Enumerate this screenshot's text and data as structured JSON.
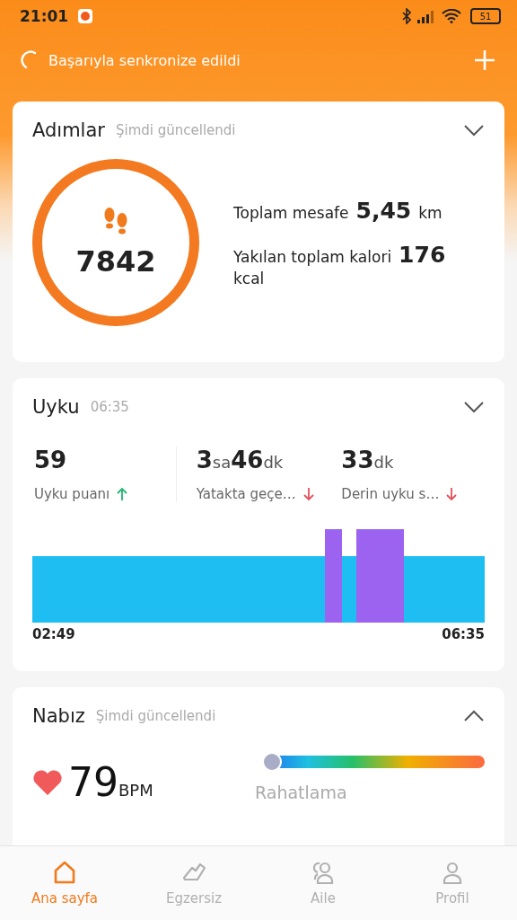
{
  "status_bar": {
    "time": "21:01",
    "battery": "51"
  },
  "header": {
    "sync_text": "Başarıyla senkronize edildi"
  },
  "steps_card": {
    "title": "Adımlar",
    "subtitle": "Şimdi güncellendi",
    "expanded": false,
    "steps": "7842",
    "distance_label": "Toplam mesafe",
    "distance_value": "5,45",
    "distance_unit": "km",
    "calories_label": "Yakılan toplam kalori",
    "calories_value": "176",
    "calories_unit": "kcal"
  },
  "sleep_card": {
    "title": "Uyku",
    "subtitle": "06:35",
    "expanded": false,
    "stats": [
      {
        "parts": [
          {
            "text": "59",
            "kind": "number"
          }
        ],
        "label": "Uyku puanı",
        "kind": "up"
      },
      {
        "parts": [
          {
            "text": "3",
            "kind": "number"
          },
          {
            "text": "sa",
            "kind": "unit"
          },
          {
            "text": "46",
            "kind": "number"
          },
          {
            "text": "dk",
            "kind": "unit"
          }
        ],
        "label": "Yatakta geçe…",
        "kind": "down"
      },
      {
        "parts": [
          {
            "text": "33",
            "kind": "number"
          },
          {
            "text": "dk",
            "kind": "unit"
          }
        ],
        "label": "Derin uyku s…",
        "kind": "down"
      }
    ],
    "start_time": "02:49",
    "end_time": "06:35"
  },
  "heart_card": {
    "title": "Nabız",
    "subtitle": "Şimdi güncellendi",
    "expanded": true,
    "value": "79",
    "unit": "BPM",
    "level": 0,
    "zone": "Rahatlama"
  },
  "nav": [
    {
      "label": "Ana sayfa",
      "selected": true
    },
    {
      "label": "Egzersiz",
      "selected": false
    },
    {
      "label": "Aile",
      "selected": false
    },
    {
      "label": "Profil",
      "selected": false
    }
  ]
}
